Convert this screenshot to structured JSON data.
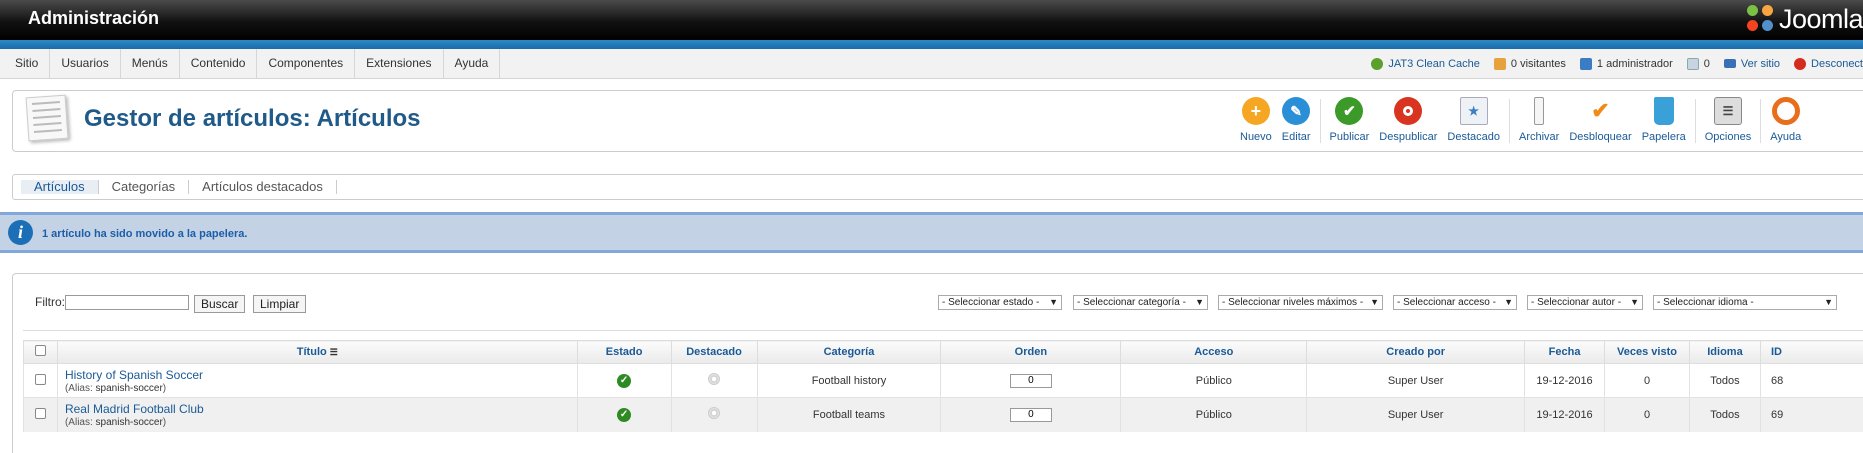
{
  "header": {
    "title": "Administración",
    "logo_text": "Joomla"
  },
  "menu": [
    "Sitio",
    "Usuarios",
    "Menús",
    "Contenido",
    "Componentes",
    "Extensiones",
    "Ayuda"
  ],
  "status": {
    "cache": "JAT3 Clean Cache",
    "visitors": "0 visitantes",
    "admins": "1 administrador",
    "messages": "0",
    "view_site": "Ver sitio",
    "logout": "Desconect"
  },
  "page": {
    "title": "Gestor de artículos: Artículos"
  },
  "toolbar": [
    {
      "label": "Nuevo",
      "icon": "plus-icon",
      "color": "#f5a623"
    },
    {
      "label": "Editar",
      "icon": "pencil-icon",
      "color": "#2a8fd6"
    },
    {
      "label": "Publicar",
      "icon": "check-icon",
      "color": "#3c9a29"
    },
    {
      "label": "Despublicar",
      "icon": "stop-icon",
      "color": "#d9341f"
    },
    {
      "label": "Destacado",
      "icon": "featured-icon",
      "color": "#9aaec0"
    },
    {
      "label": "Archivar",
      "icon": "archive-icon",
      "color": "#888888"
    },
    {
      "label": "Desbloquear",
      "icon": "checkin-icon",
      "color": "#f08a18"
    },
    {
      "label": "Papelera",
      "icon": "trash-icon",
      "color": "#3aa0d8"
    },
    {
      "label": "Opciones",
      "icon": "options-icon",
      "color": "#666666"
    },
    {
      "label": "Ayuda",
      "icon": "help-icon",
      "color": "#e86e1c"
    }
  ],
  "subnav": [
    "Artículos",
    "Categorías",
    "Artículos destacados"
  ],
  "message": "1 artículo ha sido movido a la papelera.",
  "filter": {
    "label": "Filtro:",
    "value": "",
    "search_button": "Buscar",
    "clear_button": "Limpiar",
    "selects": [
      "- Seleccionar estado -",
      "- Seleccionar categoría -",
      "- Seleccionar niveles máximos -",
      "- Seleccionar acceso -",
      "- Seleccionar autor -",
      "- Seleccionar idioma -"
    ]
  },
  "table": {
    "columns": [
      "Título",
      "Estado",
      "Destacado",
      "Categoría",
      "Orden",
      "Acceso",
      "Creado por",
      "Fecha",
      "Veces visto",
      "Idioma",
      "ID"
    ],
    "alias_label": "(Alias: ",
    "rows": [
      {
        "title": "History of Spanish Soccer",
        "alias": "spanish-soccer",
        "category": "Football history",
        "order": "0",
        "access": "Público",
        "author": "Super User",
        "date": "19-12-2016",
        "hits": "0",
        "language": "Todos",
        "id": "68"
      },
      {
        "title": "Real Madrid Football Club",
        "alias": "spanish-soccer",
        "category": "Football teams",
        "order": "0",
        "access": "Público",
        "author": "Super User",
        "date": "19-12-2016",
        "hits": "0",
        "language": "Todos",
        "id": "69"
      }
    ]
  }
}
